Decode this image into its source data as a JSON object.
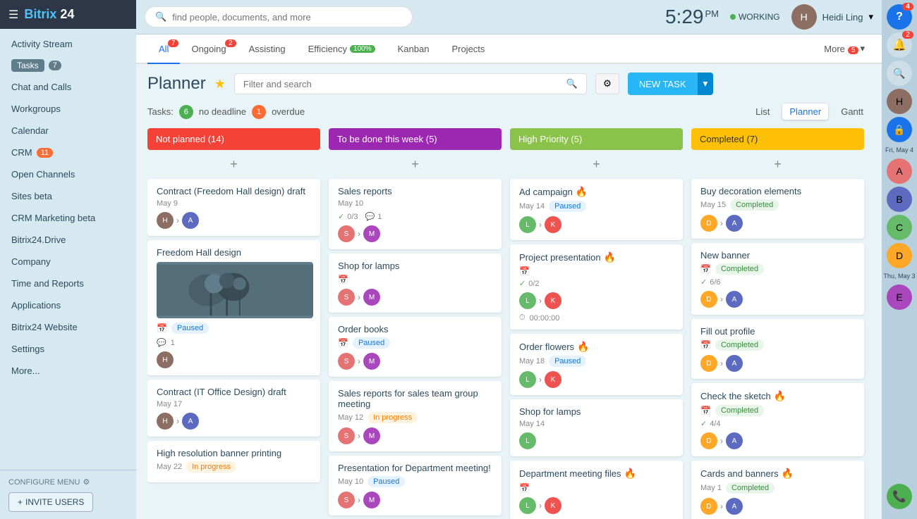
{
  "sidebar": {
    "logo": "Bitrix 24",
    "nav_items": [
      {
        "label": "Activity Stream",
        "id": "activity"
      },
      {
        "label": "Tasks",
        "id": "tasks",
        "badge": "7"
      },
      {
        "label": "Chat and Calls",
        "id": "chat"
      },
      {
        "label": "Workgroups",
        "id": "workgroups"
      },
      {
        "label": "Calendar",
        "id": "calendar"
      },
      {
        "label": "CRM",
        "id": "crm",
        "badge": "11"
      },
      {
        "label": "Open Channels",
        "id": "open-channels"
      },
      {
        "label": "Sites beta",
        "id": "sites"
      },
      {
        "label": "CRM Marketing beta",
        "id": "crm-marketing"
      },
      {
        "label": "Bitrix24.Drive",
        "id": "drive"
      },
      {
        "label": "Company",
        "id": "company"
      },
      {
        "label": "Time and Reports",
        "id": "time-reports"
      },
      {
        "label": "Applications",
        "id": "applications"
      },
      {
        "label": "Bitrix24 Website",
        "id": "website"
      },
      {
        "label": "Settings",
        "id": "settings"
      },
      {
        "label": "More...",
        "id": "more"
      }
    ],
    "configure_label": "CONFIGURE MENU",
    "invite_label": "INVITE USERS"
  },
  "topbar": {
    "search_placeholder": "find people, documents, and more",
    "time": "5:29",
    "time_period": "PM",
    "status": "WORKING",
    "user_name": "Heidi Ling"
  },
  "tabs": [
    {
      "label": "All",
      "badge": "7",
      "active": true
    },
    {
      "label": "Ongoing",
      "badge": "2"
    },
    {
      "label": "Assisting"
    },
    {
      "label": "Efficiency",
      "badge": "100%",
      "badge_green": true
    },
    {
      "label": "Kanban"
    },
    {
      "label": "Projects"
    },
    {
      "label": "More",
      "badge": "5",
      "extra": true
    }
  ],
  "planner": {
    "title": "Planner",
    "filter_placeholder": "Filter and search",
    "new_task_label": "NEW TASK",
    "stats": {
      "no_deadline_count": "6",
      "no_deadline_label": "no deadline",
      "overdue_count": "1",
      "overdue_label": "overdue"
    },
    "views": [
      "List",
      "Planner",
      "Gantt"
    ],
    "active_view": "Planner"
  },
  "columns": [
    {
      "id": "not-planned",
      "title": "Not planned",
      "count": "14",
      "color": "orange",
      "cards": [
        {
          "title": "Contract (Freedom Hall design) draft",
          "date": "May 9",
          "avatars": [
            "#8d6e63",
            "#5c6bc0"
          ],
          "id": "card-1"
        },
        {
          "title": "Freedom Hall design",
          "has_image": true,
          "status": "Paused",
          "status_type": "paused",
          "comment_count": "1",
          "avatars": [
            "#8d6e63"
          ],
          "id": "card-2"
        },
        {
          "title": "Contract (IT Office Design) draft",
          "date": "May 17",
          "avatars": [
            "#8d6e63",
            "#5c6bc0"
          ],
          "id": "card-3"
        },
        {
          "title": "High resolution banner printing",
          "date": "May 22",
          "status": "In progress",
          "status_type": "progress",
          "id": "card-4"
        }
      ]
    },
    {
      "id": "to-be-done",
      "title": "To be done this week",
      "count": "5",
      "color": "purple",
      "cards": [
        {
          "title": "Sales reports",
          "date": "May 10",
          "checklist": "0/3",
          "comment_count": "1",
          "avatars": [
            "#e57373",
            "#ab47bc"
          ],
          "id": "card-5"
        },
        {
          "title": "Shop for lamps",
          "has_calendar": true,
          "avatars": [
            "#e57373",
            "#ab47bc"
          ],
          "id": "card-6"
        },
        {
          "title": "Order books",
          "has_calendar": true,
          "status": "Paused",
          "status_type": "paused",
          "avatars": [
            "#e57373",
            "#ab47bc"
          ],
          "id": "card-7"
        },
        {
          "title": "Sales reports for sales team group meeting",
          "date": "May 12",
          "status": "In progress",
          "status_type": "progress",
          "avatars": [
            "#e57373",
            "#ab47bc"
          ],
          "id": "card-8"
        },
        {
          "title": "Presentation for Department meeting!",
          "date": "May 10",
          "status": "Paused",
          "status_type": "paused",
          "avatars": [
            "#e57373",
            "#ab47bc"
          ],
          "id": "card-9"
        }
      ]
    },
    {
      "id": "high-priority",
      "title": "High Priority",
      "count": "5",
      "color": "green",
      "cards": [
        {
          "title": "Ad campaign",
          "fire": true,
          "date": "May 14",
          "status": "Paused",
          "status_type": "paused",
          "avatars": [
            "#66bb6a",
            "#ef5350"
          ],
          "id": "card-10"
        },
        {
          "title": "Project presentation",
          "fire": true,
          "checklist": "0/2",
          "has_calendar": true,
          "time": "00:00:00",
          "avatars": [
            "#66bb6a",
            "#ef5350"
          ],
          "id": "card-11"
        },
        {
          "title": "Order flowers",
          "fire": true,
          "date": "May 18",
          "status": "Paused",
          "status_type": "paused",
          "avatars": [
            "#66bb6a",
            "#ef5350"
          ],
          "id": "card-12"
        },
        {
          "title": "Shop for lamps",
          "date": "May 14",
          "avatars": [
            "#66bb6a"
          ],
          "id": "card-13"
        },
        {
          "title": "Department meeting files",
          "fire": true,
          "has_calendar": true,
          "avatars": [
            "#66bb6a",
            "#ef5350"
          ],
          "id": "card-14"
        }
      ]
    },
    {
      "id": "completed",
      "title": "Completed",
      "count": "7",
      "color": "yellow",
      "cards": [
        {
          "title": "Buy decoration elements",
          "date": "May 15",
          "status": "Completed",
          "status_type": "completed",
          "avatars": [
            "#ffa726",
            "#5c6bc0"
          ],
          "id": "card-15"
        },
        {
          "title": "New banner",
          "status": "Completed",
          "status_type": "completed",
          "checklist": "6/6",
          "has_calendar": true,
          "avatars": [
            "#ffa726",
            "#5c6bc0"
          ],
          "id": "card-16"
        },
        {
          "title": "Fill out profile",
          "has_calendar": true,
          "status": "Completed",
          "status_type": "completed",
          "avatars": [
            "#ffa726",
            "#5c6bc0"
          ],
          "id": "card-17"
        },
        {
          "title": "Check the sketch",
          "fire": true,
          "has_calendar": true,
          "status": "Completed",
          "status_type": "completed",
          "checklist": "4/4",
          "avatars": [
            "#ffa726",
            "#5c6bc0"
          ],
          "id": "card-18"
        },
        {
          "title": "Cards and banners",
          "fire": true,
          "date": "May 1",
          "status": "Completed",
          "status_type": "completed",
          "avatars": [
            "#ffa726",
            "#5c6bc0"
          ],
          "id": "card-19"
        }
      ]
    }
  ],
  "right_panel": {
    "icons": [
      {
        "id": "question",
        "symbol": "?",
        "badge": "4"
      },
      {
        "id": "bell",
        "symbol": "🔔",
        "badge": "2"
      },
      {
        "id": "search",
        "symbol": "🔍"
      },
      {
        "id": "avatar1",
        "type": "avatar",
        "color": "#8d6e63"
      },
      {
        "id": "lock",
        "symbol": "🔒",
        "color_bg": "#1a73e8"
      },
      {
        "id": "avatar2",
        "type": "avatar",
        "color": "#e57373"
      },
      {
        "id": "avatar3",
        "type": "avatar",
        "color": "#5c6bc0"
      },
      {
        "id": "avatar4",
        "type": "avatar",
        "color": "#66bb6a"
      },
      {
        "id": "avatar5",
        "type": "avatar",
        "color": "#ffa726"
      }
    ],
    "date1": "Fri, May 4",
    "date2": "Thu, May 3",
    "phone_icon": "📞"
  }
}
